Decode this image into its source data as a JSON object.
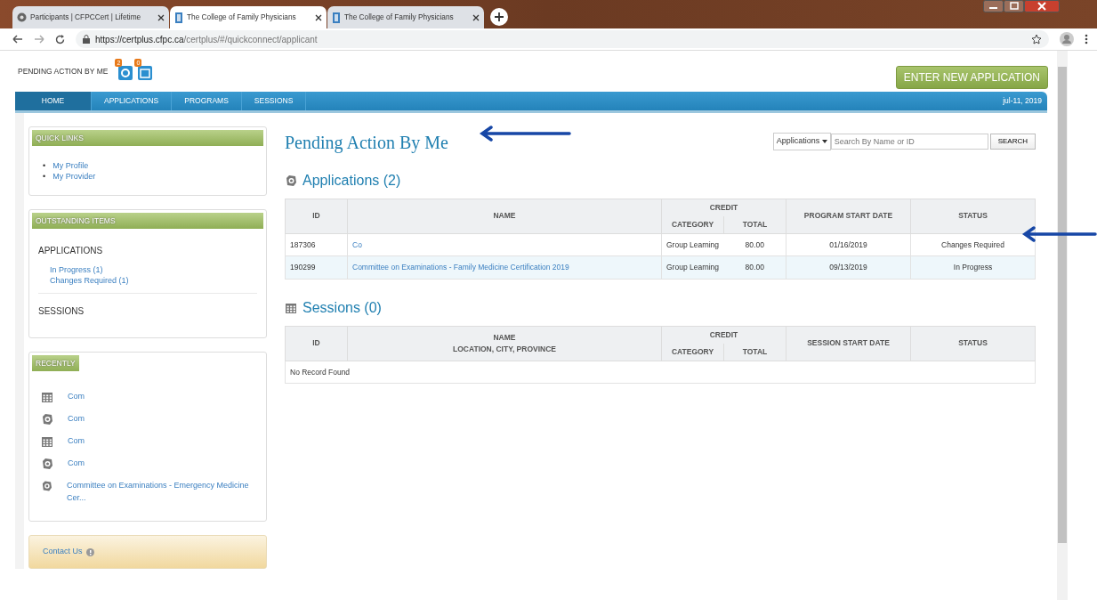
{
  "browser": {
    "tabs": [
      {
        "title": "Participants | CFPCCert | Lifetime",
        "kind": "gear",
        "selected": false
      },
      {
        "title": "The College of Family Physicians",
        "kind": "logo",
        "selected": true
      },
      {
        "title": "The College of Family Physicians",
        "kind": "logo",
        "selected": false
      }
    ],
    "url_host": "https://certplus.cfpc.ca",
    "url_path": "/certplus/#/quickconnect/applicant"
  },
  "header": {
    "pending_label": "PENDING ACTION BY ME",
    "badges": [
      {
        "count": "2",
        "kind": "application"
      },
      {
        "count": "0",
        "kind": "session"
      }
    ],
    "new_button": "ENTER NEW APPLICATION"
  },
  "nav": {
    "items": [
      {
        "label": "HOME",
        "selected": true
      },
      {
        "label": "APPLICATIONS",
        "selected": false
      },
      {
        "label": "PROGRAMS",
        "selected": false
      },
      {
        "label": "SESSIONS",
        "selected": false
      }
    ],
    "date": "jul-11, 2019"
  },
  "sidebar": {
    "quick_links": {
      "title": "QUICK LINKS",
      "links": [
        {
          "marker": "•",
          "text": "My Profile"
        },
        {
          "marker": "•",
          "text": "My Provider"
        }
      ]
    },
    "outstanding": {
      "title": "OUTSTANDING ITEMS",
      "applications_label": "APPLICATIONS",
      "application_links": [
        "In Progress (1)",
        "Changes Required (1)"
      ],
      "sessions_label": "SESSIONS"
    },
    "recently": {
      "title": "RECENTLY",
      "items": [
        {
          "kind": "session",
          "text": "Com"
        },
        {
          "kind": "application",
          "text": "Com"
        },
        {
          "kind": "session",
          "text": "Com"
        },
        {
          "kind": "application",
          "text": "Com"
        },
        {
          "kind": "application",
          "text": "Committee on Examinations - Emergency Medicine Cer..."
        }
      ]
    },
    "contact": "Contact Us"
  },
  "main": {
    "title": "Pending Action By Me",
    "search": {
      "scope": "Applications",
      "placeholder": "Search By Name or ID",
      "button": "SEARCH"
    },
    "applications": {
      "heading": "Applications (2)",
      "columns": {
        "id": "ID",
        "name": "NAME",
        "credit": "CREDIT",
        "category": "CATEGORY",
        "total": "TOTAL",
        "date": "PROGRAM START DATE",
        "status": "STATUS"
      },
      "rows": [
        {
          "id": "187306",
          "name": "Co",
          "category": "Group Learning",
          "total": "80.00",
          "date": "01/16/2019",
          "status": "Changes Required",
          "highlighted": false
        },
        {
          "id": "190299",
          "name": "Committee on Examinations - Family Medicine Certification 2019",
          "category": "Group Learning",
          "total": "80.00",
          "date": "09/13/2019",
          "status": "In Progress",
          "highlighted": true
        }
      ]
    },
    "sessions": {
      "heading": "Sessions (0)",
      "columns": {
        "id": "ID",
        "name": "NAME",
        "location": "LOCATION, CITY, PROVINCE",
        "credit": "CREDIT",
        "category": "CATEGORY",
        "total": "TOTAL",
        "date": "SESSION START DATE",
        "status": "STATUS"
      },
      "empty": "No Record Found"
    }
  }
}
